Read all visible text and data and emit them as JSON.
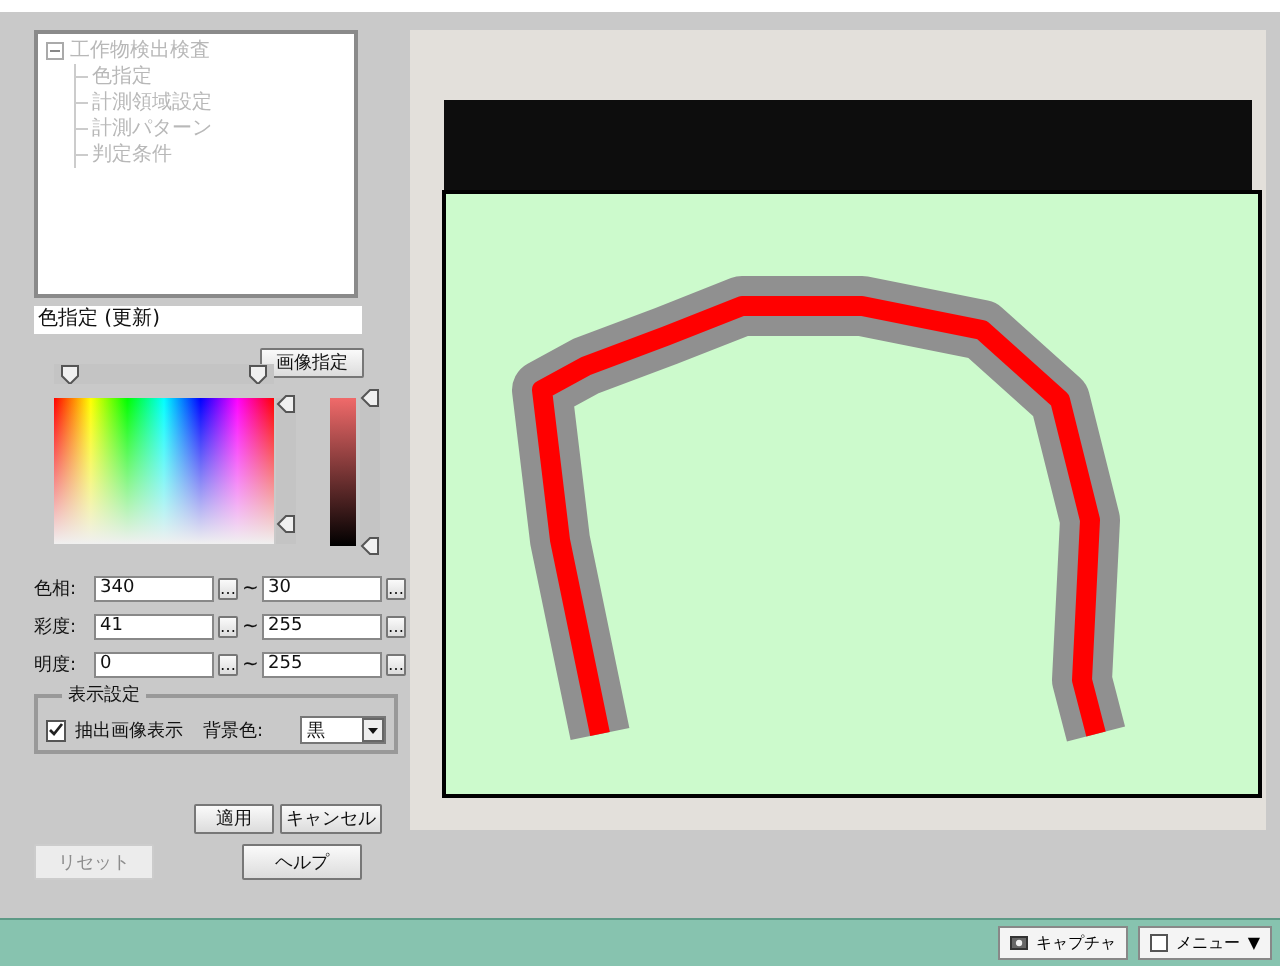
{
  "tree": {
    "label": "工作物検出検査",
    "expanded": true,
    "disabled": true,
    "children": [
      {
        "label": "色指定",
        "disabled": true
      },
      {
        "label": "計測領域設定",
        "disabled": true
      },
      {
        "label": "計測パターン",
        "disabled": true
      },
      {
        "label": "判定条件",
        "disabled": true
      }
    ]
  },
  "selection_label": "色指定 (更新)",
  "image_button": "画像指定",
  "markers": [
    {
      "kind": "hue",
      "level": 0.07
    },
    {
      "kind": "hue",
      "level": 0.93
    },
    {
      "kind": "saturation",
      "level": 0.96
    },
    {
      "kind": "saturation",
      "level": 0.14
    },
    {
      "kind": "brightness",
      "level": 1
    },
    {
      "kind": "brightness",
      "level": 0
    }
  ],
  "ranges": [
    {
      "label": "色相:",
      "from": "340",
      "from_button": "…",
      "separator": "~",
      "to": "30",
      "to_button": "…"
    },
    {
      "label": "彩度:",
      "from": "41",
      "from_button": "…",
      "separator": "~",
      "to": "255",
      "to_button": "…"
    },
    {
      "label": "明度:",
      "from": "0",
      "from_button": "…",
      "separator": "~",
      "to": "255",
      "to_button": "…"
    }
  ],
  "display_settings": {
    "title": "表示設定",
    "show_extracted": {
      "label": "抽出画像表示",
      "checked": true
    },
    "background_label": "背景色:",
    "background_value": "黒"
  },
  "buttons": [
    {
      "label": "適用"
    },
    {
      "label": "キャンセル"
    }
  ],
  "reset_button": {
    "label": "リセット",
    "disabled": true
  },
  "help_button": {
    "label": "ヘルプ"
  },
  "status_bar": {
    "capture_button": "キャプチャ",
    "menu_button": "メニュー",
    "menu_caret": "▼"
  }
}
